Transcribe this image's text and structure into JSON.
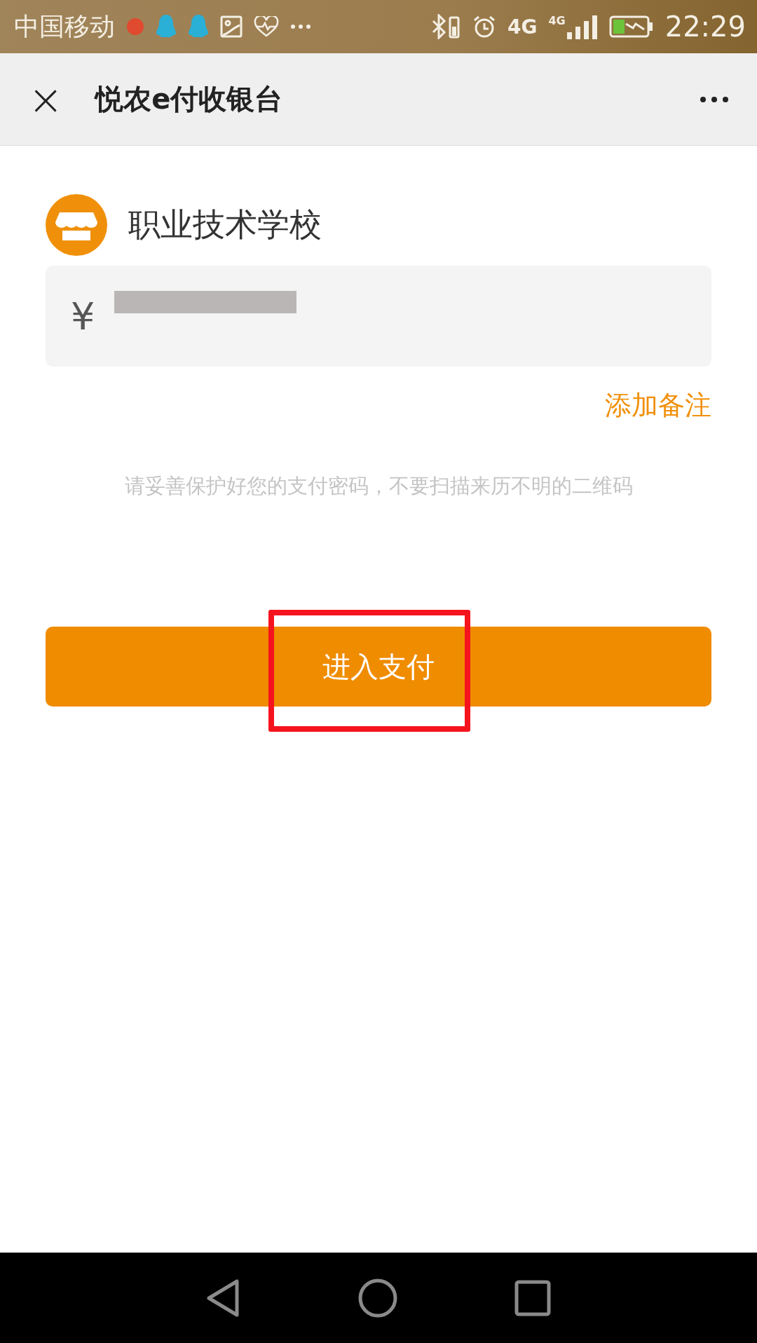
{
  "status_bar": {
    "carrier": "中国移动",
    "network_left": "4G",
    "network_right": "4G",
    "time": "22:29"
  },
  "header": {
    "close": "×",
    "title": "悦农e付收银台"
  },
  "merchant": {
    "name": "职业技术学校"
  },
  "amount_field": {
    "currency": "¥",
    "redacted": true
  },
  "remark_link": "添加备注",
  "hint": "请妥善保护好您的支付密码，不要扫描来历不明的二维码",
  "pay_button": {
    "label": "进入支付",
    "highlighted": true
  }
}
